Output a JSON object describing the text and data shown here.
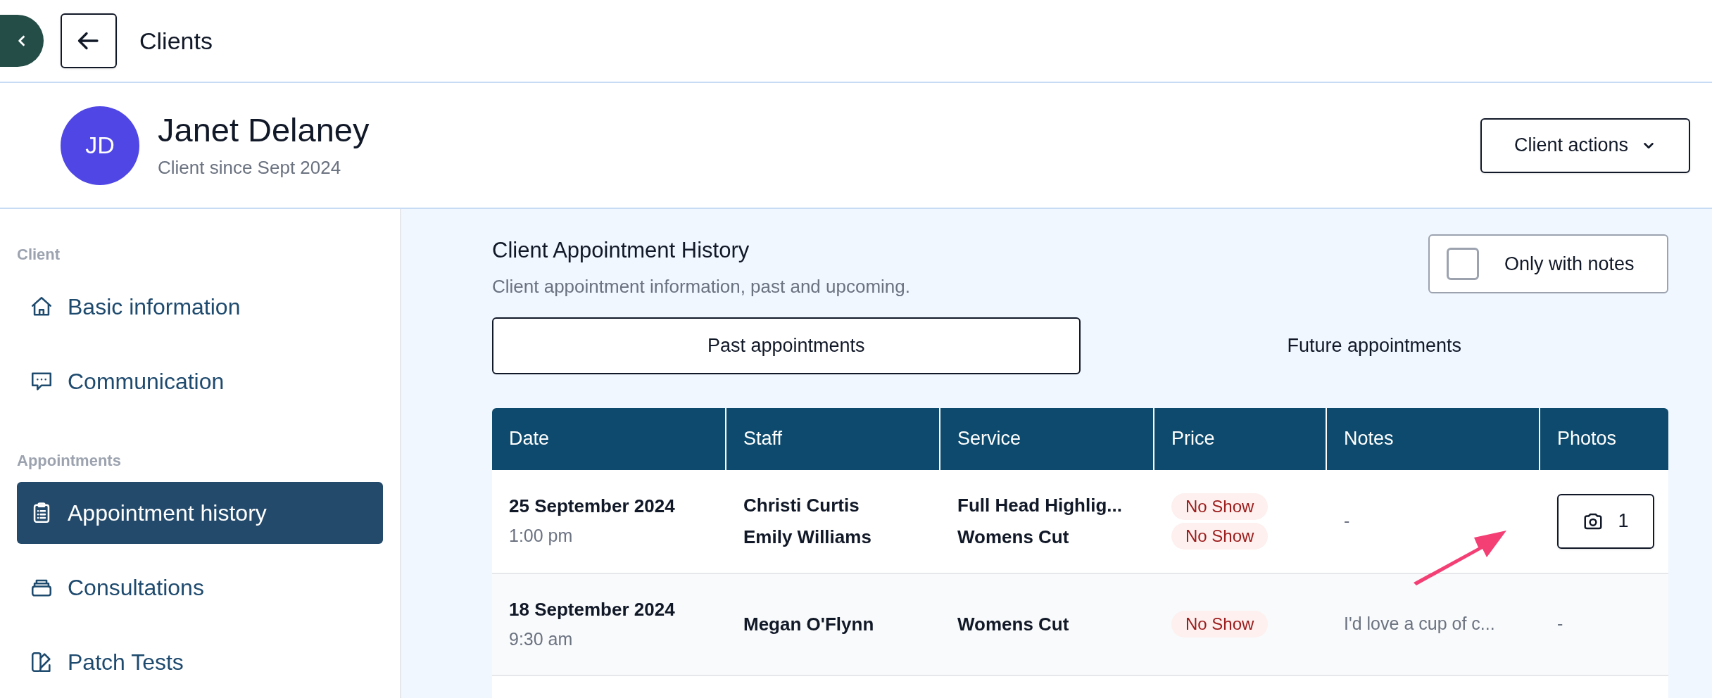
{
  "top_bar": {
    "title": "Clients"
  },
  "client": {
    "initials": "JD",
    "name": "Janet Delaney",
    "since": "Client since Sept 2024",
    "actions_button": "Client actions"
  },
  "sidebar": {
    "sections": [
      {
        "label": "Client",
        "items": [
          {
            "label": "Basic information",
            "selected": false
          },
          {
            "label": "Communication",
            "selected": false
          }
        ]
      },
      {
        "label": "Appointments",
        "items": [
          {
            "label": "Appointment history",
            "selected": true
          },
          {
            "label": "Consultations",
            "selected": false
          },
          {
            "label": "Patch Tests",
            "selected": false
          }
        ]
      }
    ]
  },
  "history": {
    "title": "Client Appointment History",
    "subtitle": "Client appointment information, past and upcoming.",
    "filter": {
      "label": "Only with notes",
      "checked": false
    },
    "tabs": [
      {
        "label": "Past appointments",
        "selected": true
      },
      {
        "label": "Future appointments",
        "selected": false
      }
    ],
    "table": {
      "columns": [
        "Date",
        "Staff",
        "Service",
        "Price",
        "Notes",
        "Photos"
      ],
      "rows": [
        {
          "date": "25 September 2024",
          "time": "1:00 pm",
          "staff": [
            "Christi Curtis",
            "Emily Williams"
          ],
          "services": [
            "Full Head Highlig...",
            "Womens Cut"
          ],
          "prices": [
            "No Show",
            "No Show"
          ],
          "notes": "-",
          "photos": {
            "kind": "button",
            "count": "1"
          }
        },
        {
          "date": "18 September 2024",
          "time": "9:30 am",
          "staff": [
            "Megan O'Flynn"
          ],
          "services": [
            "Womens Cut"
          ],
          "prices": [
            "No Show"
          ],
          "notes": "I'd love a cup of c...",
          "photos": {
            "kind": "text",
            "text": "-"
          }
        }
      ]
    }
  }
}
